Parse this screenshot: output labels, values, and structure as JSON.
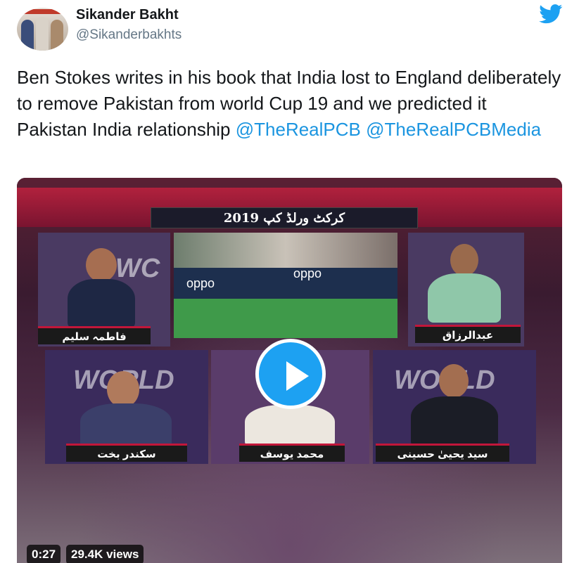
{
  "author": {
    "name": "Sikander Bakht",
    "handle": "@Sikanderbakhts"
  },
  "tweet": {
    "text": "Ben Stokes writes in his book that India lost to England deliberately to remove Pakistan from world Cup 19 and we predicted it   Pakistan India relationship ",
    "mentions": [
      "@TheRealPCB",
      "@TheRealPCBMedia"
    ]
  },
  "video": {
    "title": "کرکٹ ورلڈ کپ 2019",
    "captions": {
      "top_left": "فاطمہ سلیم",
      "top_right": "عبدالرزاق",
      "bottom_left": "سکندر بخت",
      "bottom_middle": "محمد یوسف",
      "bottom_right": "سید یحییٰ حسینی"
    },
    "duration": "0:27",
    "views": "29.4K views"
  },
  "colors": {
    "link": "#1b95e0",
    "twitter_blue": "#1da1f2",
    "handle_gray": "#657786"
  }
}
